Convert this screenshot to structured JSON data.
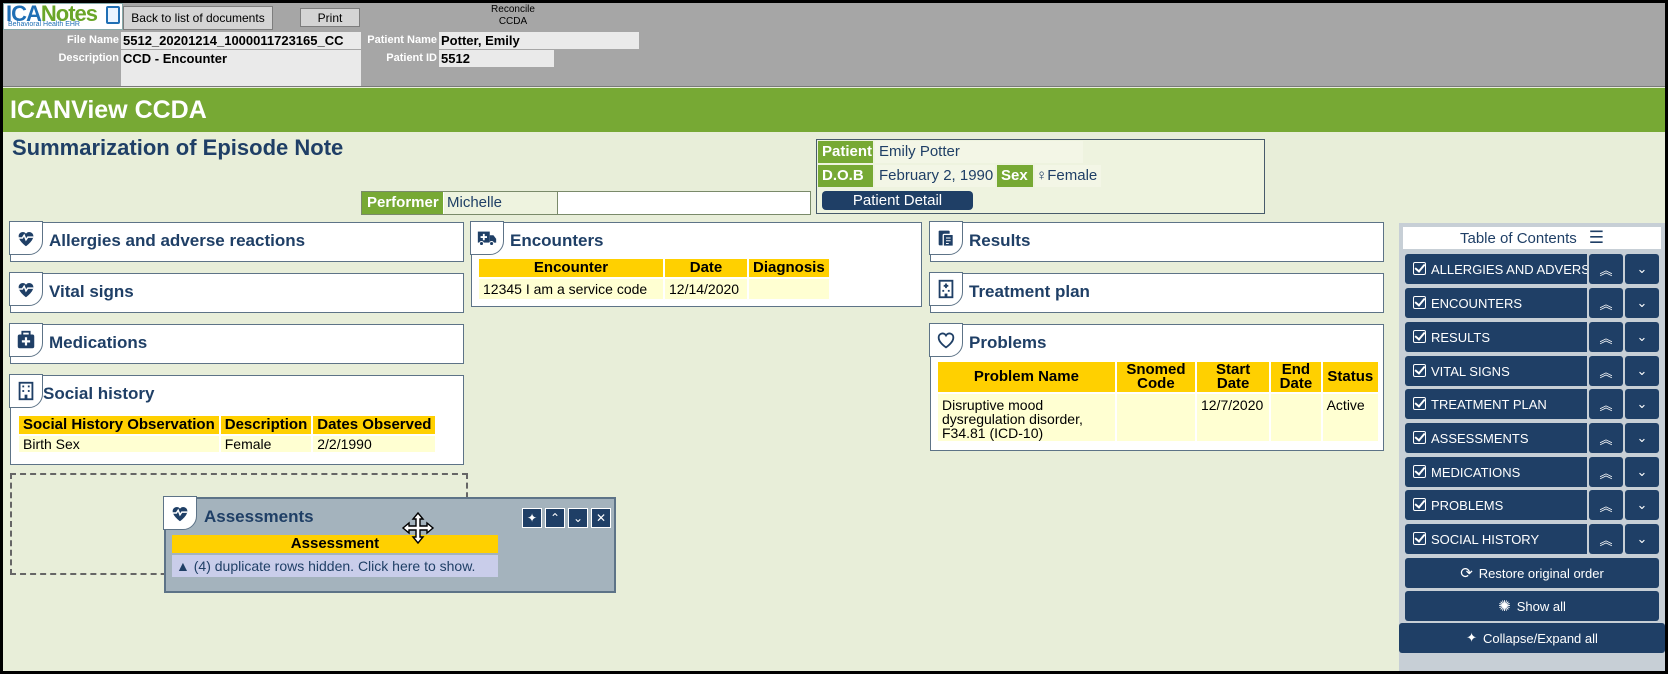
{
  "logo": {
    "brand_a": "ICA",
    "brand_b": "Notes",
    "tagline": "Behavioral Health EHR"
  },
  "toolbar": {
    "back_label": "Back to list of documents",
    "print_label": "Print",
    "reconcile_line1": "Reconcile",
    "reconcile_line2": "CCDA"
  },
  "file": {
    "name_label": "File Name",
    "name_value": "5512_20201214_1000011723165_CC",
    "desc_label": "Description",
    "desc_value": "CCD - Encounter",
    "patient_name_label": "Patient Name",
    "patient_name_value": "Potter, Emily",
    "patient_id_label": "Patient ID",
    "patient_id_value": "5512"
  },
  "header": {
    "app_title": "ICANView CCDA",
    "doc_title": "Summarization of Episode Note"
  },
  "patient": {
    "patient_label": "Patient",
    "patient_value": "Emily Potter",
    "dob_label": "D.O.B",
    "dob_value": "February 2, 1990",
    "sex_label": "Sex",
    "sex_value": "♀Female",
    "detail_button": "Patient Detail"
  },
  "performer": {
    "label": "Performer",
    "value": "Michelle"
  },
  "sections": {
    "allergies": "Allergies and adverse reactions",
    "vitals": "Vital signs",
    "medications": "Medications",
    "social": "Social history",
    "encounters": "Encounters",
    "results": "Results",
    "treatment": "Treatment plan",
    "problems": "Problems",
    "assessments": "Assessments"
  },
  "social_table": {
    "headers": [
      "Social History Observation",
      "Description",
      "Dates Observed"
    ],
    "rows": [
      [
        "Birth Sex",
        "Female",
        "2/2/1990"
      ]
    ]
  },
  "encounter_table": {
    "headers": [
      "Encounter",
      "Date",
      "Diagnosis"
    ],
    "rows": [
      [
        "12345 I am a service code",
        "12/14/2020",
        ""
      ]
    ]
  },
  "problem_table": {
    "headers": [
      "Problem Name",
      "Snomed Code",
      "Start Date",
      "End Date",
      "Status"
    ],
    "rows": [
      [
        "Disruptive mood dysregulation disorder, F34.81 (ICD-10)",
        "",
        "12/7/2020",
        "",
        "Active"
      ]
    ]
  },
  "assessment_table": {
    "header": "Assessment",
    "duplicate_notice": "(4) duplicate rows hidden. Click here to show."
  },
  "toc": {
    "title": "Table of Contents",
    "items": [
      "ALLERGIES AND ADVERSE",
      "ENCOUNTERS",
      "RESULTS",
      "VITAL SIGNS",
      "TREATMENT PLAN",
      "ASSESSMENTS",
      "MEDICATIONS",
      "PROBLEMS",
      "SOCIAL HISTORY"
    ],
    "restore_label": "Restore original order",
    "show_all_label": "Show all",
    "collapse_label": "Collapse/Expand all"
  },
  "colors": {
    "green": "#77a934",
    "navy": "#1f3f66",
    "header_yellow": "#ffd000",
    "cell_cream": "#ffffd2"
  }
}
